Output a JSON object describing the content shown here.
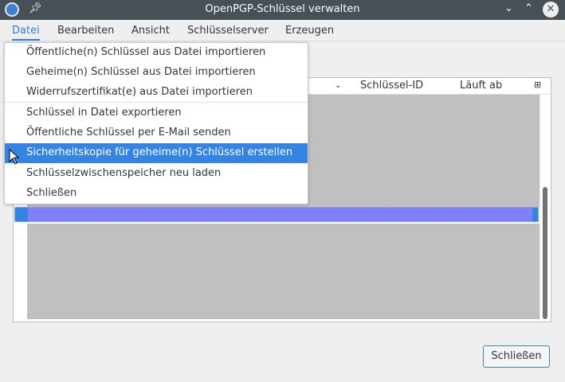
{
  "window": {
    "title": "OpenPGP-Schlüssel verwalten",
    "minimize": "⌄",
    "maximize": "⌃",
    "close": "✕"
  },
  "menubar": [
    "Datei",
    "Bearbeiten",
    "Ansicht",
    "Schlüsselserver",
    "Erzeugen"
  ],
  "file_menu": {
    "items": [
      "Öffentliche(n) Schlüssel aus Datei importieren",
      "Geheime(n) Schlüssel aus Datei importieren",
      "Widerrufszertifikat(e) aus Datei importieren",
      "Schlüssel in Datei exportieren",
      "Öffentliche Schlüssel per E-Mail senden",
      "Sicherheitskopie für geheime(n) Schlüssel erstellen",
      "Schlüsselzwischenspeicher neu laden",
      "Schließen"
    ],
    "highlighted": "Sicherheitskopie für geheime(n) Schlüssel erstellen"
  },
  "table": {
    "columns": [
      "Schlüssel-ID",
      "Läuft ab"
    ]
  },
  "footer": {
    "close_button": "Schließen"
  },
  "colors": {
    "accent": "#3584e4",
    "selection": "#8080ff",
    "titlebar": "#475057"
  }
}
